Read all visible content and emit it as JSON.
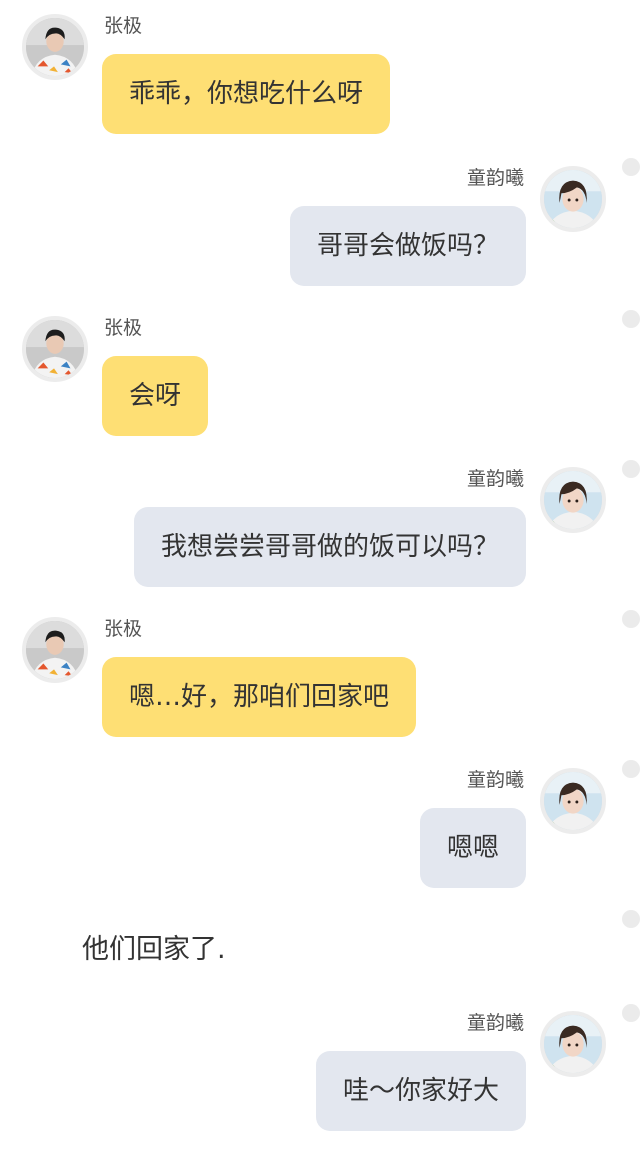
{
  "characters": {
    "left": {
      "name": "张极",
      "bubble_color": "#fedf74",
      "avatar_icon": "avatar-zhangji-icon"
    },
    "right": {
      "name": "童韵曦",
      "bubble_color": "#e3e7ef",
      "avatar_icon": "avatar-tongyunxi-icon"
    }
  },
  "messages": [
    {
      "side": "left",
      "sender": "张极",
      "text": "乖乖，你想吃什么呀"
    },
    {
      "side": "right",
      "sender": "童韵曦",
      "text": "哥哥会做饭吗？"
    },
    {
      "side": "left",
      "sender": "张极",
      "text": "会呀"
    },
    {
      "side": "right",
      "sender": "童韵曦",
      "text": "我想尝尝哥哥做的饭可以吗？"
    },
    {
      "side": "left",
      "sender": "张极",
      "text": "嗯…好，那咱们回家吧"
    },
    {
      "side": "right",
      "sender": "童韵曦",
      "text": "嗯嗯"
    },
    {
      "side": "narration",
      "text": "他们回家了."
    },
    {
      "side": "right",
      "sender": "童韵曦",
      "text": "哇～你家好大"
    }
  ]
}
